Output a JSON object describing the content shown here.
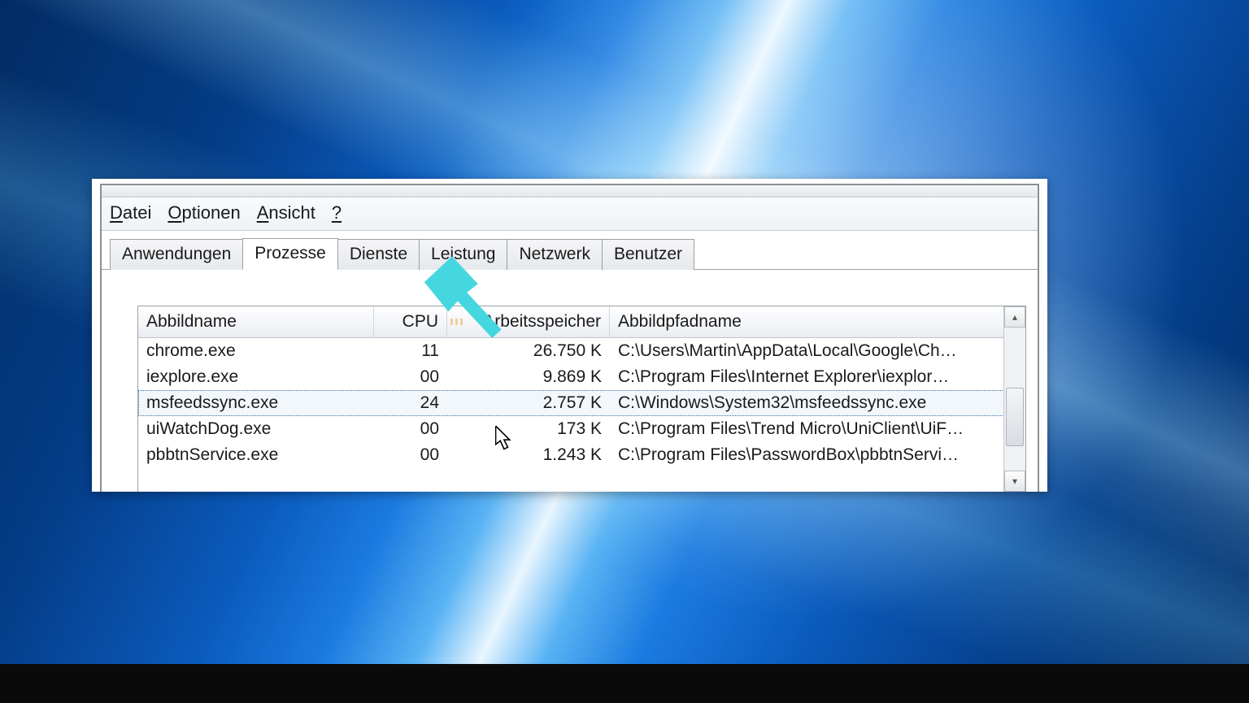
{
  "menubar": {
    "file": "Datei",
    "options": "Optionen",
    "view": "Ansicht",
    "help": "?"
  },
  "tabs": {
    "applications": "Anwendungen",
    "processes": "Prozesse",
    "services": "Dienste",
    "performance": "Leistung",
    "network": "Netzwerk",
    "users": "Benutzer"
  },
  "columns": {
    "image_name": "Abbildname",
    "cpu": "CPU",
    "memory": "Arbeitsspeicher",
    "image_path": "Abbildpfadname"
  },
  "rows": [
    {
      "name": "chrome.exe",
      "cpu": "11",
      "mem": "26.750 K",
      "path": "C:\\Users\\Martin\\AppData\\Local\\Google\\Ch…"
    },
    {
      "name": "iexplore.exe",
      "cpu": "00",
      "mem": "9.869 K",
      "path": "C:\\Program Files\\Internet Explorer\\iexplor…"
    },
    {
      "name": "msfeedssync.exe",
      "cpu": "24",
      "mem": "2.757 K",
      "path": "C:\\Windows\\System32\\msfeedssync.exe"
    },
    {
      "name": "uiWatchDog.exe",
      "cpu": "00",
      "mem": "173 K",
      "path": "C:\\Program Files\\Trend Micro\\UniClient\\UiF…"
    },
    {
      "name": "pbbtnService.exe",
      "cpu": "00",
      "mem": "1.243 K",
      "path": "C:\\Program Files\\PasswordBox\\pbbtnServi…"
    }
  ],
  "selected_row_index": 2,
  "annotation": {
    "arrow_color": "#45d7e0"
  }
}
